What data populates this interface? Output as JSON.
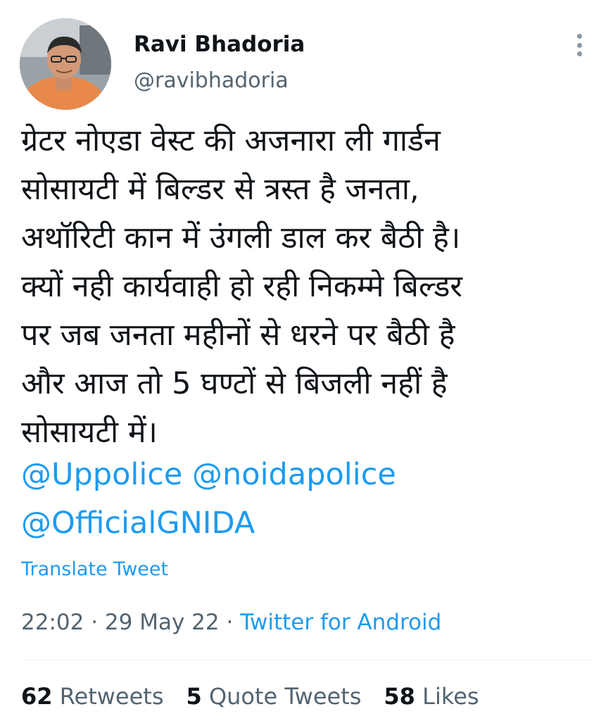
{
  "author": {
    "name": "Ravi Bhadoria",
    "handle": "@ravibhadoria"
  },
  "tweet": {
    "lines": [
      "ग्रेटर नोएडा वेस्ट की अजनारा ली गार्डन",
      "सोसायटी में बिल्डर से त्रस्त है जनता,",
      "अथॉरिटी कान में उंगली डाल कर बैठी है।",
      "क्यों नही कार्यवाही हो रही निकम्मे बिल्डर",
      "पर जब जनता महीनों से धरने पर बैठी है",
      "और आज तो 5 घण्टों से बिजली नहीं है",
      "सोसायटी में।"
    ],
    "mentions": {
      "uppolice": "@Uppolice",
      "noidapolice": "@noidapolice",
      "gnida": "@OfficialGNIDA"
    },
    "translate_label": "Translate Tweet",
    "time": "22:02",
    "date": "29 May 22",
    "source": "Twitter for Android",
    "separator": "·"
  },
  "stats": {
    "retweets": {
      "count": "62",
      "label": "Retweets"
    },
    "quotes": {
      "count": "5",
      "label": "Quote Tweets"
    },
    "likes": {
      "count": "58",
      "label": "Likes"
    }
  },
  "colors": {
    "link": "#1d9bf0",
    "secondary": "#536471",
    "primary": "#0f1419"
  },
  "icons": {
    "more": "more-vertical-icon"
  }
}
